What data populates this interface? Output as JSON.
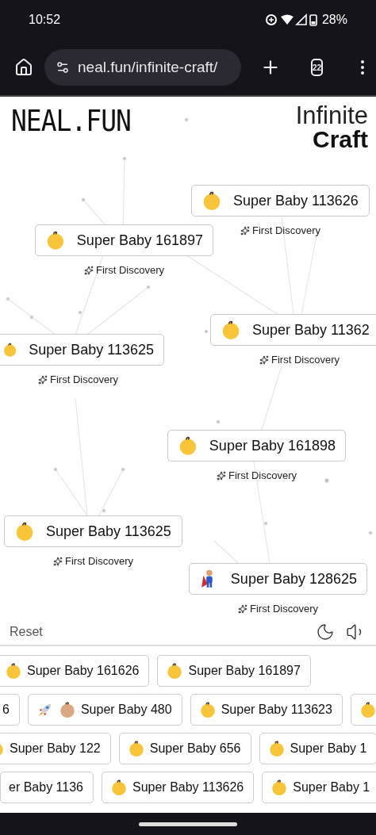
{
  "status_bar": {
    "time": "10:52",
    "battery": "28%"
  },
  "browser": {
    "url": "neal.fun/infinite-craft/",
    "tab_count": "22"
  },
  "header": {
    "logo": "NEAL.FUN",
    "title_top": "Infinite",
    "title_bottom": "Craft"
  },
  "canvas_items": [
    {
      "kind": "baby",
      "label": "Super Baby 113626",
      "note": "First Discovery"
    },
    {
      "kind": "baby",
      "label": "Super Baby 161897",
      "note": "First Discovery"
    },
    {
      "kind": "baby",
      "label": "Super Baby 113625",
      "note": "First Discovery"
    },
    {
      "kind": "baby",
      "label": "Super Baby 11362",
      "note": "First Discovery"
    },
    {
      "kind": "baby",
      "label": "Super Baby 161898",
      "note": "First Discovery"
    },
    {
      "kind": "baby",
      "label": "Super Baby 113625",
      "note": "First Discovery"
    },
    {
      "kind": "superhero",
      "label": "Super Baby 128625",
      "note": "First Discovery"
    }
  ],
  "toolbar": {
    "reset": "Reset"
  },
  "sidebar_rows": [
    [
      {
        "kind": "baby",
        "label": "Super Baby 161626"
      },
      {
        "kind": "baby",
        "label": "Super Baby 161897"
      }
    ],
    [
      {
        "kind": "plain",
        "label": "6"
      },
      {
        "kind": "rocket-baby",
        "label": "Super Baby 480"
      },
      {
        "kind": "baby",
        "label": "Super Baby 113623"
      },
      {
        "kind": "baby"
      }
    ],
    [
      {
        "kind": "baby",
        "label": "Super Baby 122"
      },
      {
        "kind": "baby",
        "label": "Super Baby 656"
      },
      {
        "kind": "baby",
        "label": "Super Baby 1"
      }
    ],
    [
      {
        "kind": "plain",
        "label": "er Baby 1136"
      },
      {
        "kind": "baby",
        "label": "Super Baby 113626"
      },
      {
        "kind": "baby",
        "label": "Super Baby 1"
      }
    ]
  ]
}
